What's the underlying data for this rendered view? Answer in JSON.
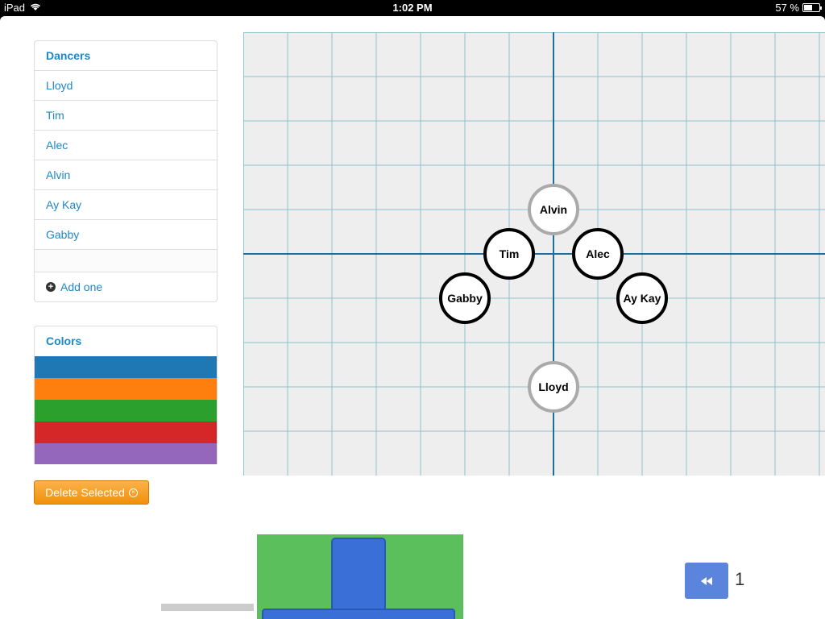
{
  "status": {
    "device": "iPad",
    "time": "1:02 PM",
    "battery": "57 %",
    "battery_level": 0.57
  },
  "dancers_panel": {
    "title": "Dancers",
    "items": [
      {
        "label": "Lloyd"
      },
      {
        "label": "Tim"
      },
      {
        "label": "Alec"
      },
      {
        "label": "Alvin"
      },
      {
        "label": "Ay Kay"
      },
      {
        "label": "Gabby"
      }
    ],
    "add_label": "Add one"
  },
  "colors_panel": {
    "title": "Colors",
    "swatches": [
      "#1f77b4",
      "#ff7f0e",
      "#2ca02c",
      "#d62728",
      "#9467bd"
    ]
  },
  "delete_button": "Delete Selected",
  "stage": {
    "dancers": [
      {
        "name": "Alvin",
        "ring": "gray"
      },
      {
        "name": "Tim",
        "ring": "black"
      },
      {
        "name": "Alec",
        "ring": "black"
      },
      {
        "name": "Gabby",
        "ring": "black"
      },
      {
        "name": "Ay Kay",
        "ring": "black"
      },
      {
        "name": "Lloyd",
        "ring": "gray"
      }
    ]
  },
  "pagination": {
    "current_page": "1"
  }
}
